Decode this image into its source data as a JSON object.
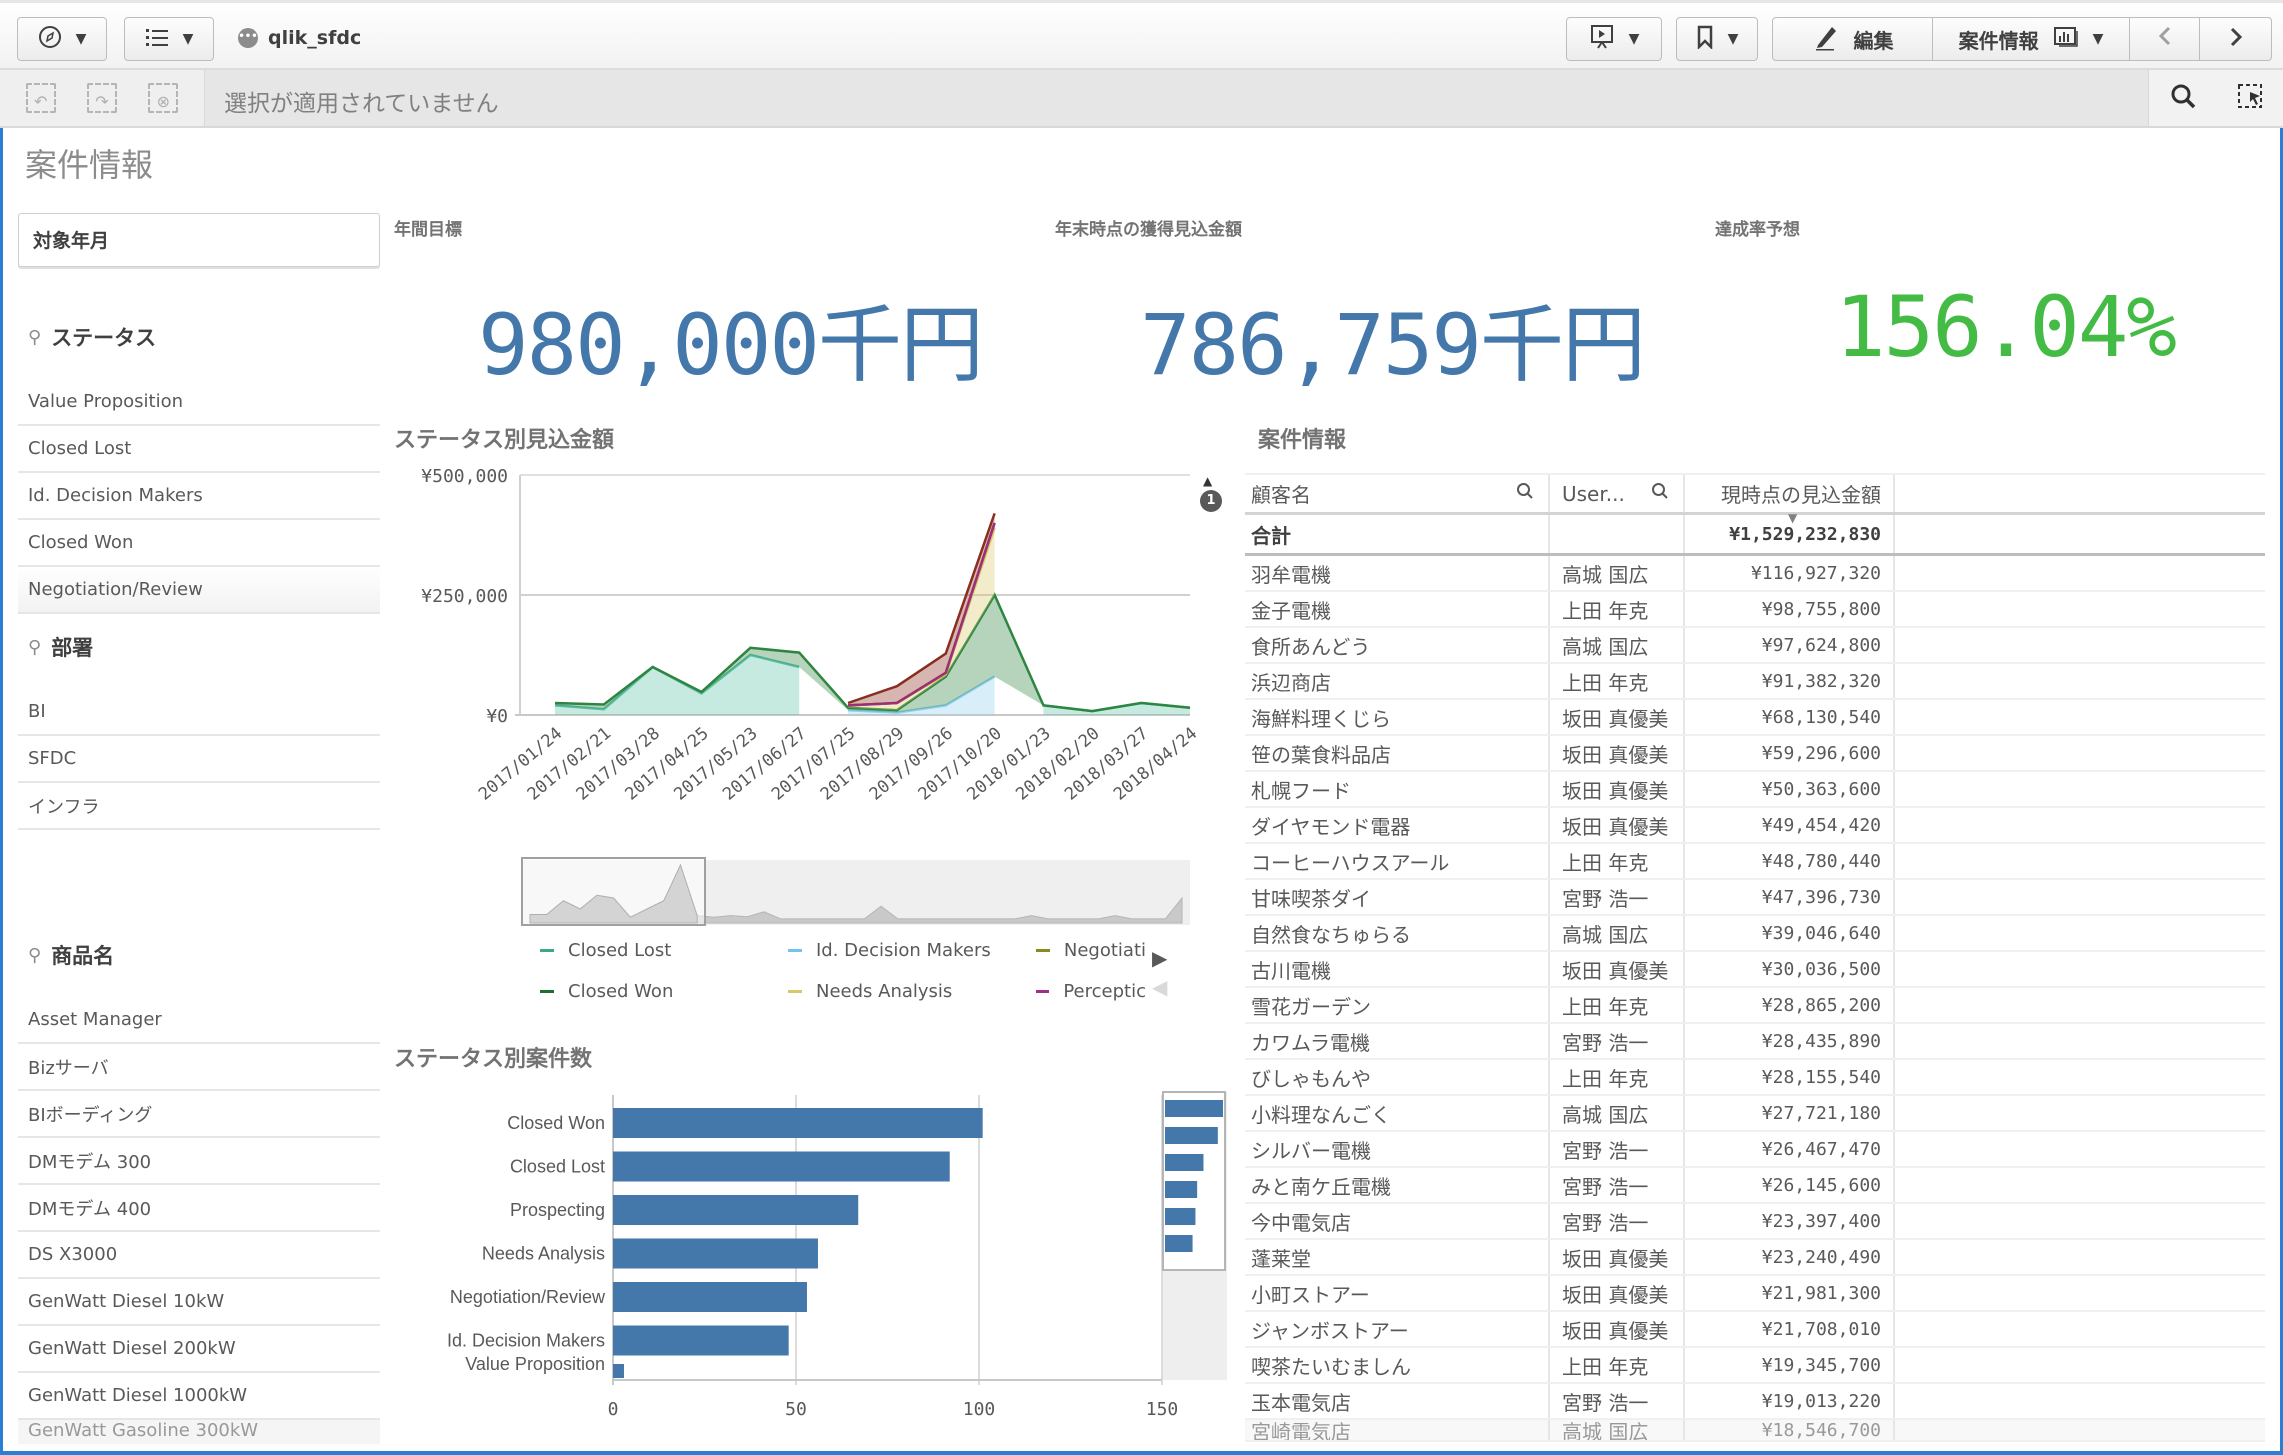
{
  "toolbar": {
    "app_name": "qlik_sfdc",
    "edit_label": "編集",
    "sheet_selector_label": "案件情報",
    "icons": {
      "nav": "compass-icon",
      "list": "list-icon",
      "present": "presentation-icon",
      "bookmark": "bookmark-icon",
      "edit": "pencil-icon",
      "sheet": "sheet-chart-icon",
      "prev": "chevron-left-icon",
      "next": "chevron-right-icon"
    }
  },
  "selection_bar": {
    "status_text": "選択が適用されていません",
    "icons": [
      "step-back-icon",
      "step-forward-icon",
      "clear-selections-icon"
    ],
    "right_icons": [
      "search-icon",
      "selection-tool-icon"
    ]
  },
  "sheet": {
    "title": "案件情報"
  },
  "filters": {
    "date_filter": "対象年月",
    "status": {
      "title": "ステータス",
      "items": [
        "Value Proposition",
        "Closed Lost",
        "Id. Decision Makers",
        "Closed Won",
        "Negotiation/Review"
      ]
    },
    "department": {
      "title": "部署",
      "items": [
        "BI",
        "SFDC",
        "インフラ"
      ]
    },
    "product": {
      "title": "商品名",
      "items": [
        "Asset Manager",
        "Bizサーバ",
        "BIボーディング",
        "DMモデム 300",
        "DMモデム 400",
        "DS X3000",
        "GenWatt Diesel 10kW",
        "GenWatt Diesel 200kW",
        "GenWatt Diesel 1000kW"
      ],
      "partial_item": "GenWatt Gasoline 300kW"
    }
  },
  "kpis": [
    {
      "label": "年間目標",
      "value": "980,000千円",
      "color": "#4477aa"
    },
    {
      "label": "年末時点の獲得見込金額",
      "value": "786,759千円",
      "color": "#4477aa"
    },
    {
      "label": "達成率予想",
      "value": "156.04%",
      "color": "#44bb44"
    }
  ],
  "area_chart_title": "ステータス別見込金額",
  "bar_chart_title": "ステータス別案件数",
  "scroll_badge": "1",
  "chart_data": [
    {
      "type": "area",
      "title": "ステータス別見込金額",
      "stacked": true,
      "x": [
        "2017/01/24",
        "2017/02/21",
        "2017/03/28",
        "2017/04/25",
        "2017/05/23",
        "2017/06/27",
        "2017/07/25",
        "2017/08/29",
        "2017/09/26",
        "2017/10/20",
        "2018/01/23",
        "2018/02/20",
        "2018/03/27",
        "2018/04/24"
      ],
      "y_ticks": [
        "¥0",
        "¥250,000",
        "¥500,000"
      ],
      "ylim": [
        0,
        500000
      ],
      "grid": true,
      "series": [
        {
          "name": "Closed Lost",
          "color": "#5bbfa6",
          "values": [
            20000,
            12000,
            100000,
            45000,
            125000,
            100000,
            null,
            null,
            null,
            null,
            20000,
            8000,
            25000,
            15000
          ]
        },
        {
          "name": "Id. Decision Makers",
          "color": "#8fd0ee",
          "values": [
            null,
            null,
            null,
            null,
            null,
            null,
            10000,
            5000,
            20000,
            80000,
            null,
            null,
            null,
            null
          ]
        },
        {
          "name": "Closed Won",
          "color": "#2e8540",
          "values": [
            5000,
            10000,
            0,
            3000,
            15000,
            30000,
            5000,
            5000,
            60000,
            170000,
            0,
            0,
            0,
            0
          ]
        },
        {
          "name": "Needs Analysis",
          "color": "#d9c86a",
          "values": [
            null,
            null,
            null,
            null,
            null,
            null,
            5000,
            15000,
            5000,
            140000,
            null,
            null,
            null,
            null
          ]
        },
        {
          "name": "Negotiation/Review",
          "color": "#8a8a1e",
          "values": [
            null,
            null,
            null,
            null,
            null,
            null,
            0,
            0,
            3000,
            10000,
            null,
            null,
            null,
            null
          ]
        },
        {
          "name": "Perception Analysis",
          "color": "#a02f8a",
          "values": [
            null,
            null,
            null,
            null,
            null,
            null,
            0,
            0,
            0,
            0,
            null,
            null,
            null,
            null
          ]
        },
        {
          "name": "Prospecting",
          "color": "#8b2e22",
          "values": [
            null,
            null,
            null,
            null,
            null,
            null,
            5000,
            35000,
            40000,
            20000,
            null,
            null,
            null,
            null
          ]
        }
      ],
      "legend": [
        "Closed Lost",
        "Closed Won",
        "Id. Decision Makers",
        "Needs Analysis",
        "Negotiati",
        "Perceptic"
      ],
      "legend_position": "bottom"
    },
    {
      "type": "bar",
      "orientation": "horizontal",
      "title": "ステータス別案件数",
      "categories": [
        "Closed Won",
        "Closed Lost",
        "Prospecting",
        "Needs Analysis",
        "Negotiation/Review",
        "Id. Decision Makers",
        "Value Proposition"
      ],
      "values": [
        101,
        92,
        67,
        56,
        53,
        48,
        3
      ],
      "x_ticks": [
        "0",
        "50",
        "100",
        "150"
      ],
      "xlim": [
        0,
        150
      ],
      "color": "#4477aa",
      "grid": true
    }
  ],
  "table": {
    "title": "案件情報",
    "columns": [
      "顧客名",
      "User...",
      "現時点の見込金額"
    ],
    "total_label": "合計",
    "total_value": "¥1,529,232,830",
    "rows": [
      [
        "羽牟電機",
        "高城 国広",
        "¥116,927,320"
      ],
      [
        "金子電機",
        "上田 年克",
        "¥98,755,800"
      ],
      [
        "食所あんどう",
        "高城 国広",
        "¥97,624,800"
      ],
      [
        "浜辺商店",
        "上田 年克",
        "¥91,382,320"
      ],
      [
        "海鮮料理くじら",
        "坂田 真優美",
        "¥68,130,540"
      ],
      [
        "笹の葉食料品店",
        "坂田 真優美",
        "¥59,296,600"
      ],
      [
        "札幌フード",
        "坂田 真優美",
        "¥50,363,600"
      ],
      [
        "ダイヤモンド電器",
        "坂田 真優美",
        "¥49,454,420"
      ],
      [
        "コーヒーハウスアール",
        "上田 年克",
        "¥48,780,440"
      ],
      [
        "甘味喫茶ダイ",
        "宮野 浩一",
        "¥47,396,730"
      ],
      [
        "自然食なちゅらる",
        "高城 国広",
        "¥39,046,640"
      ],
      [
        "古川電機",
        "坂田 真優美",
        "¥30,036,500"
      ],
      [
        "雪花ガーデン",
        "上田 年克",
        "¥28,865,200"
      ],
      [
        "カワムラ電機",
        "宮野 浩一",
        "¥28,435,890"
      ],
      [
        "びしゃもんや",
        "上田 年克",
        "¥28,155,540"
      ],
      [
        "小料理なんごく",
        "高城 国広",
        "¥27,721,180"
      ],
      [
        "シルバー電機",
        "宮野 浩一",
        "¥26,467,470"
      ],
      [
        "みと南ケ丘電機",
        "宮野 浩一",
        "¥26,145,600"
      ],
      [
        "今中電気店",
        "宮野 浩一",
        "¥23,397,400"
      ],
      [
        "蓬莱堂",
        "坂田 真優美",
        "¥23,240,490"
      ],
      [
        "小町ストアー",
        "坂田 真優美",
        "¥21,981,300"
      ],
      [
        "ジャンボストアー",
        "坂田 真優美",
        "¥21,708,010"
      ],
      [
        "喫茶たいむましん",
        "上田 年克",
        "¥19,345,700"
      ],
      [
        "玉本電気店",
        "宮野 浩一",
        "¥19,013,220"
      ]
    ],
    "partial_row": [
      "宮崎電気店",
      "高城 国広",
      "¥18,546,700"
    ]
  }
}
